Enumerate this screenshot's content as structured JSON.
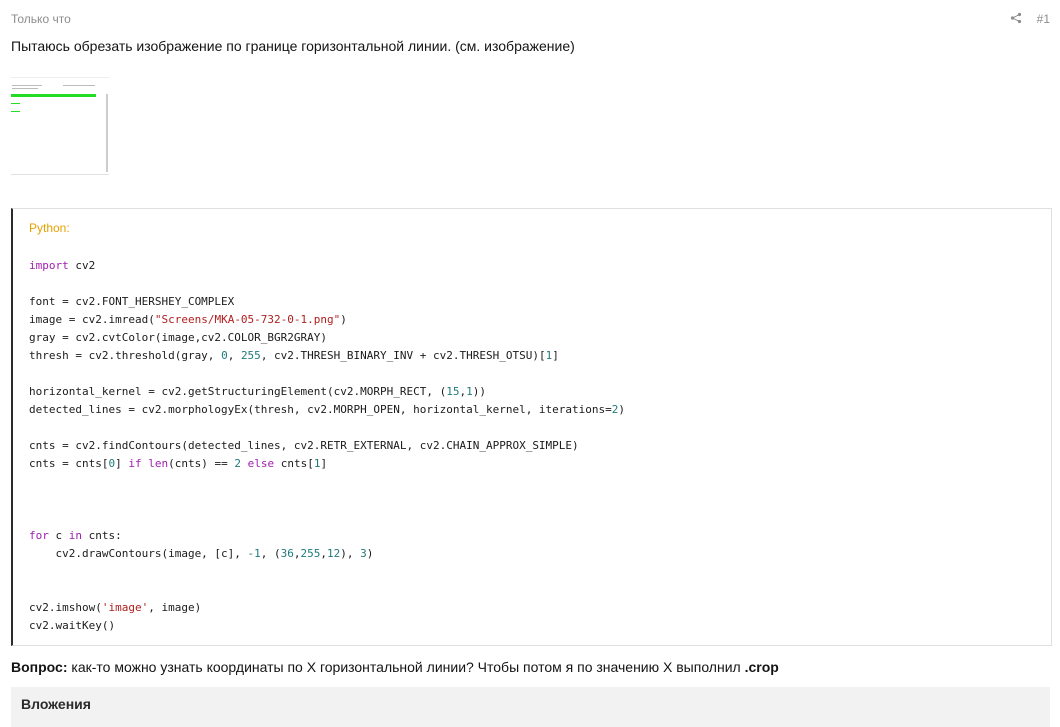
{
  "post": {
    "timestamp": "Только что",
    "number": "#1",
    "intro": "Пытаюсь обрезать изображение по границе горизонтальной линии. (см. изображение)"
  },
  "code": {
    "title": "Python:",
    "lines": [
      [
        {
          "t": "import",
          "c": "kw"
        },
        {
          "t": " cv2"
        }
      ],
      [],
      [
        {
          "t": "font = cv2.FONT_HERSHEY_COMPLEX"
        }
      ],
      [
        {
          "t": "image = cv2.imread("
        },
        {
          "t": "\"Screens/MKA-05-732-0-1.png\"",
          "c": "st"
        },
        {
          "t": ")"
        }
      ],
      [
        {
          "t": "gray = cv2.cvtColor(image,cv2.COLOR_BGR2GRAY)"
        }
      ],
      [
        {
          "t": "thresh = cv2.threshold(gray, "
        },
        {
          "t": "0",
          "c": "nm"
        },
        {
          "t": ", "
        },
        {
          "t": "255",
          "c": "nm"
        },
        {
          "t": ", cv2.THRESH_BINARY_INV + cv2.THRESH_OTSU)["
        },
        {
          "t": "1",
          "c": "nm"
        },
        {
          "t": "]"
        }
      ],
      [],
      [
        {
          "t": "horizontal_kernel = cv2.getStructuringElement(cv2.MORPH_RECT, ("
        },
        {
          "t": "15",
          "c": "nm"
        },
        {
          "t": ","
        },
        {
          "t": "1",
          "c": "nm"
        },
        {
          "t": "))"
        }
      ],
      [
        {
          "t": "detected_lines = cv2.morphologyEx(thresh, cv2.MORPH_OPEN, horizontal_kernel, iterations="
        },
        {
          "t": "2",
          "c": "nm"
        },
        {
          "t": ")"
        }
      ],
      [],
      [
        {
          "t": "cnts = cv2.findContours(detected_lines, cv2.RETR_EXTERNAL, cv2.CHAIN_APPROX_SIMPLE)"
        }
      ],
      [
        {
          "t": "cnts = cnts["
        },
        {
          "t": "0",
          "c": "nm"
        },
        {
          "t": "] "
        },
        {
          "t": "if",
          "c": "kw"
        },
        {
          "t": " "
        },
        {
          "t": "len",
          "c": "kw"
        },
        {
          "t": "(cnts) == "
        },
        {
          "t": "2",
          "c": "nm"
        },
        {
          "t": " "
        },
        {
          "t": "else",
          "c": "kw"
        },
        {
          "t": " cnts["
        },
        {
          "t": "1",
          "c": "nm"
        },
        {
          "t": "]"
        }
      ],
      [],
      [],
      [],
      [
        {
          "t": "for",
          "c": "kw"
        },
        {
          "t": " c "
        },
        {
          "t": "in",
          "c": "kw"
        },
        {
          "t": " cnts:"
        }
      ],
      [
        {
          "t": "    cv2.drawContours(image, [c], "
        },
        {
          "t": "-1",
          "c": "nm"
        },
        {
          "t": ", ("
        },
        {
          "t": "36",
          "c": "nm"
        },
        {
          "t": ","
        },
        {
          "t": "255",
          "c": "nm"
        },
        {
          "t": ","
        },
        {
          "t": "12",
          "c": "nm"
        },
        {
          "t": "), "
        },
        {
          "t": "3",
          "c": "nm"
        },
        {
          "t": ")"
        }
      ],
      [],
      [],
      [
        {
          "t": "cv2.imshow("
        },
        {
          "t": "'image'",
          "c": "st"
        },
        {
          "t": ", image)"
        }
      ],
      [
        {
          "t": "cv2.waitKey()"
        }
      ]
    ]
  },
  "question": {
    "label": "Вопрос:",
    "text": " как-то можно узнать координаты по X горизонтальной линии? Чтобы потом я по значению X выполнил ",
    "code_word": ".crop"
  },
  "attachments": {
    "label": "Вложения"
  },
  "icons": {
    "share": "share-icon"
  }
}
